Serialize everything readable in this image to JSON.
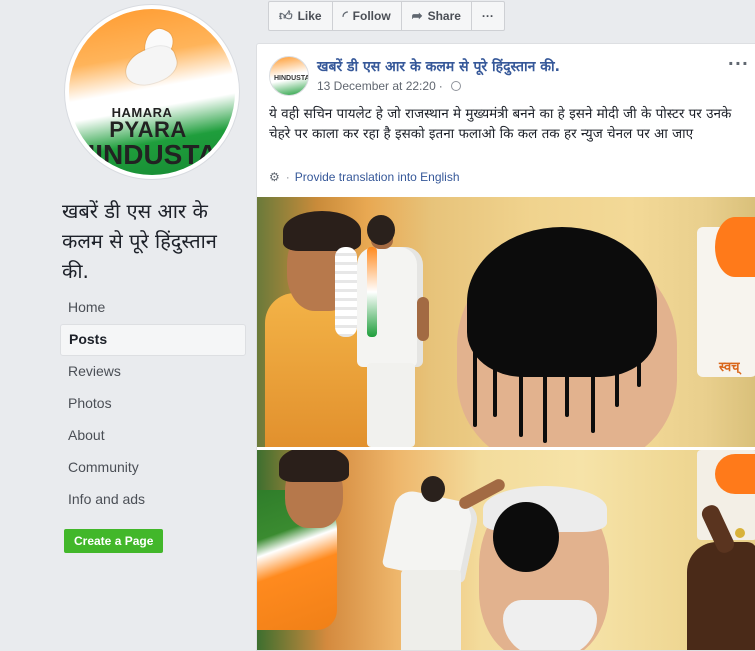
{
  "sidebar": {
    "avatar_text": [
      "HAMARA",
      "PYARA",
      "HINDUSTAN"
    ],
    "page_title": "खबरें डी एस आर के कलम से पूरे हिंदुस्तान की.",
    "nav": [
      {
        "label": "Home",
        "active": false
      },
      {
        "label": "Posts",
        "active": true
      },
      {
        "label": "Reviews",
        "active": false
      },
      {
        "label": "Photos",
        "active": false
      },
      {
        "label": "About",
        "active": false
      },
      {
        "label": "Community",
        "active": false
      },
      {
        "label": "Info and ads",
        "active": false
      }
    ],
    "create_page_label": "Create a Page"
  },
  "actionbar": {
    "like_label": "Like",
    "follow_label": "Follow",
    "share_label": "Share",
    "more_label": "···"
  },
  "post": {
    "author": "खबरें डी एस आर के कलम से पूरे हिंदुस्तान की.",
    "timestamp": "13 December at 22:20",
    "menu_label": "···",
    "text": "ये वही सचिन पायलेट हे जो राजस्थान मे मुख्यमंत्री बनने का हे इसने मोदी जी के पोस्टर पर उनके चेहरे पर काला कर रहा है इसको इतना फलाओ कि कल तक हर न्युज चेनल पर आ जाए",
    "translate_label": "Provide translation into English",
    "photo_text": "स्वच्"
  },
  "colors": {
    "link": "#365899",
    "page_bg": "#e9ebee",
    "create_button": "#42b72a"
  },
  "icons": [
    "like-icon",
    "follow-icon",
    "share-icon",
    "globe-icon",
    "gear-icon"
  ]
}
